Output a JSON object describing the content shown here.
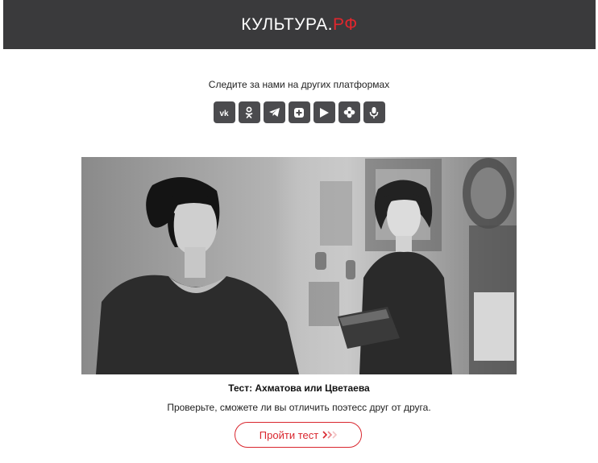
{
  "header": {
    "logo_main": "КУЛЬТУРА.",
    "logo_accent": "РФ",
    "accent_color": "#e1262d",
    "bar_color": "#3a3a3c"
  },
  "follow": {
    "text": "Следите за нами на других платформах",
    "icons": [
      "vk-icon",
      "odnoklassniki-icon",
      "telegram-icon",
      "rutube-icon",
      "vk-video-icon",
      "dzen-icon",
      "podcast-icon"
    ]
  },
  "article": {
    "image_description": "Black and white photograph of two women",
    "title": "Тест: Ахматова или Цветаева",
    "description": "Проверьте, сможете ли вы отличить поэтесс друг от друга.",
    "cta_label": "Пройти тест",
    "cta_color": "#d9262e"
  }
}
